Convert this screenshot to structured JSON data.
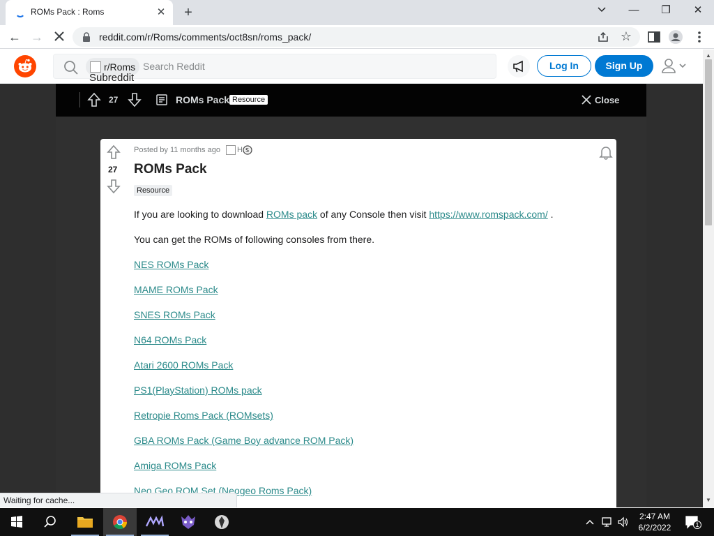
{
  "browser": {
    "tab_title": "ROMs Pack : Roms",
    "tab_close": "✕",
    "new_tab": "+",
    "window_minimize": "—",
    "window_restore": "❐",
    "window_close": "✕",
    "url": "reddit.com/r/Roms/comments/oct8sn/roms_pack/",
    "nav_back": "←",
    "nav_forward": "→",
    "bookmark_star": "☆"
  },
  "reddit_header": {
    "subreddit_chip": "r/Roms",
    "subreddit_alt": "Subreddit",
    "search_placeholder": "Search Reddit",
    "login_label": "Log In",
    "signup_label": "Sign Up"
  },
  "post_bar": {
    "vote_count": "27",
    "title": "ROMs Pack",
    "flair": "Resource",
    "close_label": "Close"
  },
  "post": {
    "vote_count": "27",
    "meta_posted": "Posted by",
    "meta_time": "11 months ago",
    "award_alt": "H",
    "title": "ROMs Pack",
    "flair": "Resource",
    "intro_text_1": "If you are looking to download ",
    "intro_link": "ROMs pack",
    "intro_text_2": " of any Console then visit ",
    "intro_url": "https://www.romspack.com/",
    "intro_text_3": " .",
    "consoles_text": "You can get the ROMs of following consoles from there.",
    "links": [
      "NES ROMs Pack",
      "MAME ROMs Pack",
      "SNES ROMs Pack",
      "N64 ROMs Pack",
      "Atari 2600 ROMs Pack",
      "PS1(PlayStation) ROMs pack",
      "Retropie Roms Pack (ROMsets)",
      "GBA ROMs Pack (Game Boy advance ROM Pack)",
      "Amiga ROMs Pack",
      "Neo Geo ROM Set (Neogeo Roms Pack)"
    ]
  },
  "status_bar": {
    "text": "Waiting for cache..."
  },
  "taskbar": {
    "time": "2:47 AM",
    "date": "6/2/2022",
    "notification_count": "1"
  },
  "colors": {
    "reddit_orange": "#ff4500",
    "reddit_blue": "#0079d3",
    "link_teal": "#2b8a8a"
  }
}
